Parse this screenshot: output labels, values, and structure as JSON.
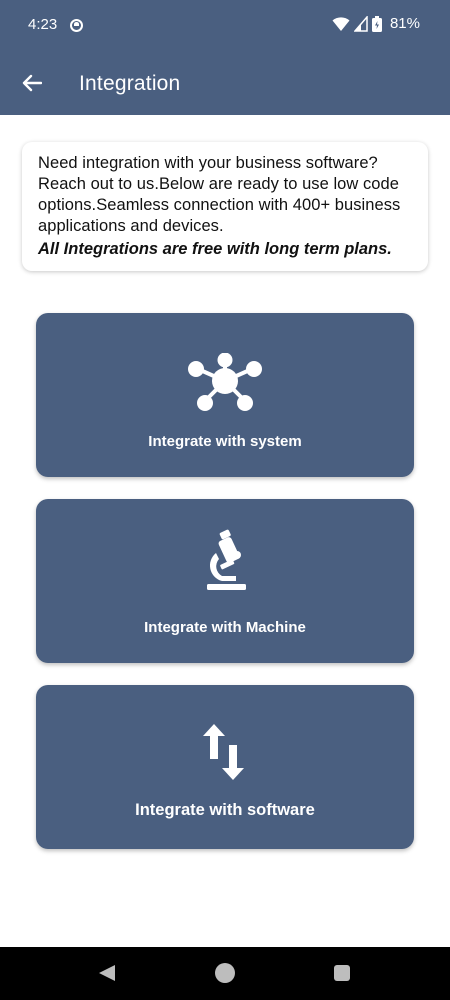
{
  "status_bar": {
    "time": "4:23",
    "battery": "81%"
  },
  "toolbar": {
    "title": "Integration",
    "back_icon": "arrow-left-icon"
  },
  "info": {
    "text": "Need integration with your business software? Reach out to us.Below are ready to use low code options.Seamless connection with 400+ business applications and devices.",
    "note": "All Integrations are free with long term plans."
  },
  "options": [
    {
      "label": "Integrate with system",
      "icon": "hub-network-icon"
    },
    {
      "label": "Integrate with Machine",
      "icon": "microscope-icon"
    },
    {
      "label": "Integrate with software",
      "icon": "swap-vertical-arrows-icon"
    }
  ],
  "colors": {
    "primary": "#4a5f80",
    "background": "#ffffff",
    "text": "#111111"
  }
}
